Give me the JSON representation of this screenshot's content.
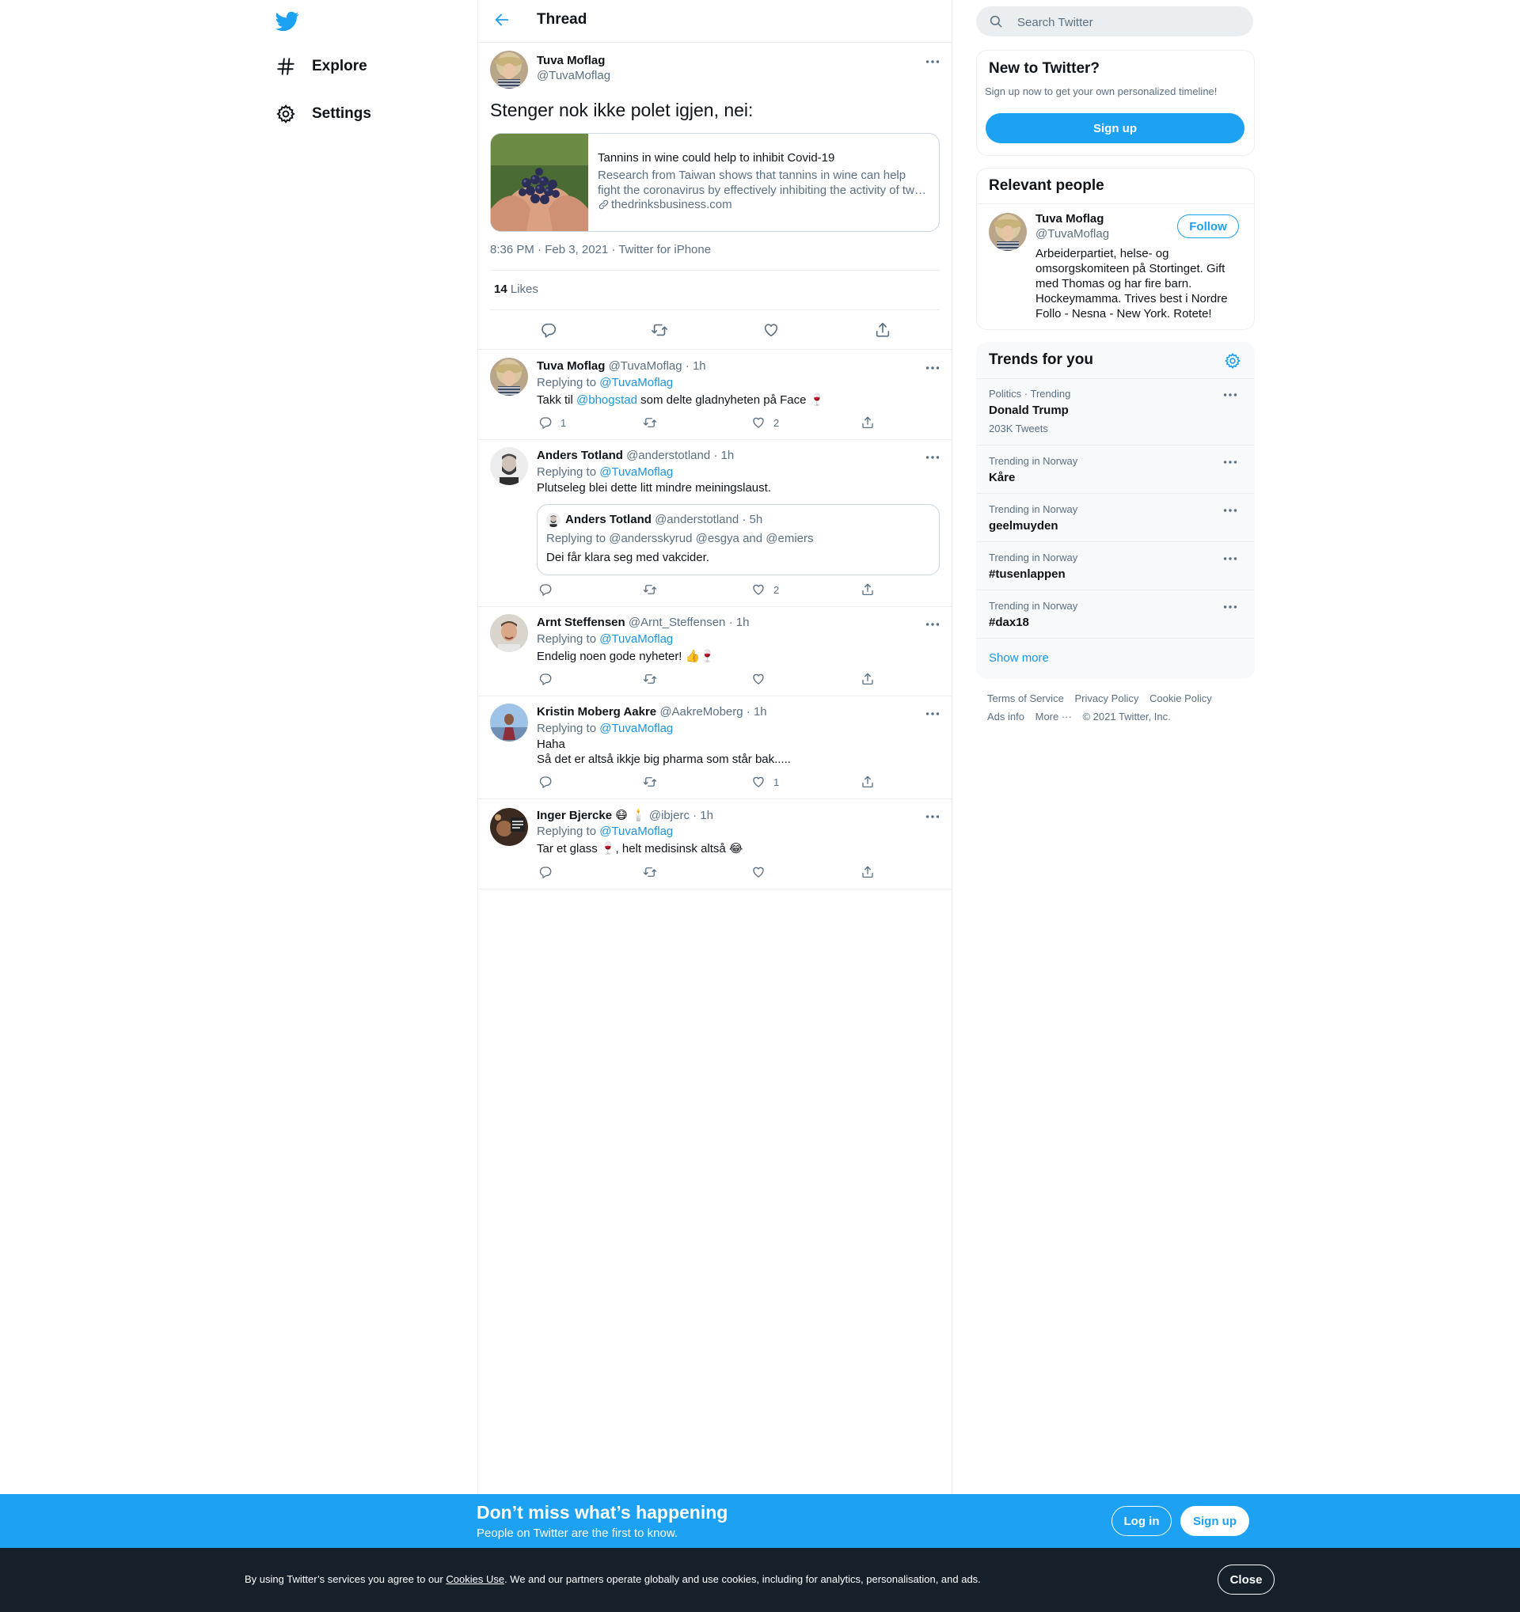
{
  "nav": {
    "logo_icon": "twitter-bird-icon",
    "items": [
      {
        "label": "Explore",
        "icon": "hashtag-icon"
      },
      {
        "label": "Settings",
        "icon": "gear-icon"
      }
    ]
  },
  "header": {
    "title": "Thread"
  },
  "tweet": {
    "author_name": "Tuva Moflag",
    "author_handle": "@TuvaMoflag",
    "text": "Stenger nok ikke polet igjen, nei:",
    "card": {
      "title": "Tannins in wine could help to inhibit Covid-19",
      "description": "Research from Taiwan shows that tannins in wine can help fight the coronavirus by effectively inhibiting the activity of two key enzymes.",
      "domain": "thedrinksbusiness.com"
    },
    "time": "8:36 PM · Feb 3, 2021",
    "source": "Twitter for iPhone",
    "likes_count": "14",
    "likes_label": "Likes"
  },
  "replies": [
    {
      "name": "Tuva Moflag",
      "handle": "@TuvaMoflag",
      "time": "1h",
      "replying_label": "Replying to",
      "replying_to": "@TuvaMoflag",
      "text_before": "Takk til ",
      "mention": "@bhogstad",
      "text_after": " som delte gladnyheten på Face 🍷",
      "reply_count": "1",
      "retweet_count": "",
      "like_count": "2"
    },
    {
      "name": "Anders Totland",
      "handle": "@anderstotland",
      "time": "1h",
      "replying_label": "Replying to",
      "replying_to": "@TuvaMoflag",
      "text": "Plutseleg blei dette litt mindre meiningslaust.",
      "quote": {
        "name": "Anders Totland",
        "handle": "@anderstotland",
        "time": "5h",
        "replying": "Replying to @andersskyrud @esgya and @emiers",
        "text": "Dei får klara seg med vakcider."
      },
      "reply_count": "",
      "retweet_count": "",
      "like_count": "2"
    },
    {
      "name": "Arnt Steffensen",
      "handle": "@Arnt_Steffensen",
      "time": "1h",
      "replying_label": "Replying to",
      "replying_to": "@TuvaMoflag",
      "text": "Endelig noen gode nyheter! 👍🍷",
      "reply_count": "",
      "retweet_count": "",
      "like_count": ""
    },
    {
      "name": "Kristin Moberg Aakre",
      "handle": "@AakreMoberg",
      "time": "1h",
      "replying_label": "Replying to",
      "replying_to": "@TuvaMoflag",
      "text": "Haha\nSå det er altså ikkje big pharma som står bak.....",
      "reply_count": "",
      "retweet_count": "",
      "like_count": "1"
    },
    {
      "name": "Inger Bjercke 😷 🕯️",
      "handle": "@ibjerc",
      "time": "1h",
      "replying_label": "Replying to",
      "replying_to": "@TuvaMoflag",
      "text": "Tar et glass  🍷, helt medisinsk altså 😂",
      "reply_count": "",
      "retweet_count": "",
      "like_count": ""
    }
  ],
  "sidebar": {
    "search_placeholder": "Search Twitter",
    "new_to_twitter": {
      "title": "New to Twitter?",
      "text": "Sign up now to get your own personalized timeline!",
      "button": "Sign up"
    },
    "relevant_people": {
      "title": "Relevant people",
      "name": "Tuva Moflag",
      "handle": "@TuvaMoflag",
      "follow": "Follow",
      "bio": "Arbeiderpartiet, helse- og omsorgskomiteen på Stortinget. Gift med Thomas og har fire barn. Hockeymamma. Trives best i Nordre Follo - Nesna - New York. Rotete!"
    },
    "trends": {
      "title": "Trends for you",
      "items": [
        {
          "meta": "Politics · Trending",
          "name": "Donald Trump",
          "count": "203K Tweets"
        },
        {
          "meta": "Trending in Norway",
          "name": "Kåre",
          "count": ""
        },
        {
          "meta": "Trending in Norway",
          "name": "geelmuyden",
          "count": ""
        },
        {
          "meta": "Trending in Norway",
          "name": "#tusenlappen",
          "count": ""
        },
        {
          "meta": "Trending in Norway",
          "name": "#dax18",
          "count": ""
        }
      ],
      "show_more": "Show more"
    },
    "footer": {
      "terms": "Terms of Service",
      "privacy": "Privacy Policy",
      "cookie": "Cookie Policy",
      "ads": "Ads info",
      "more": "More ···",
      "copyright": "© 2021 Twitter, Inc."
    }
  },
  "banner": {
    "title": "Don’t miss what’s happening",
    "subtitle": "People on Twitter are the first to know.",
    "login": "Log in",
    "signup": "Sign up"
  },
  "cookie_bar": {
    "text_before": "By using Twitter’s services you agree to our ",
    "link": "Cookies Use",
    "text_after": ". We and our partners operate globally and use cookies, including for analytics, personalisation, and ads.",
    "close": "Close"
  },
  "colors": {
    "accent": "#1da1f2",
    "link": "#1b95e0",
    "muted": "#5b7083",
    "cookie_bg": "#15202b"
  }
}
